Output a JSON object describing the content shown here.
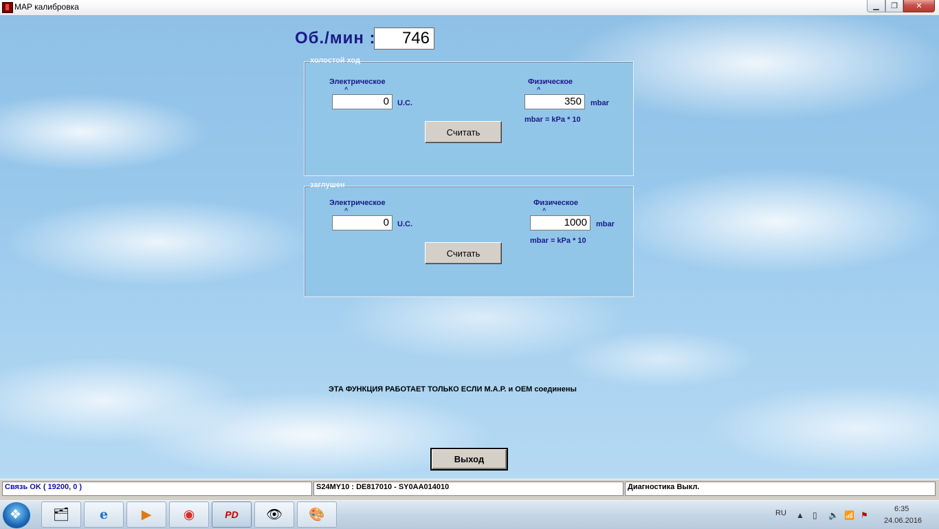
{
  "window": {
    "title": "MAP калибровка",
    "buttons": {
      "minimize": "▁",
      "maximize": "❐",
      "close": "✕"
    }
  },
  "rpm": {
    "label": "Об./мин :",
    "value": "746"
  },
  "idle_panel": {
    "caption": "холостой ход",
    "electrical": {
      "label": "Электрическое",
      "value": "0",
      "unit": "U.C."
    },
    "physical": {
      "label": "Физическое",
      "value": "350",
      "unit": "mbar",
      "formula": "mbar = kPa * 10"
    },
    "read_button": "Считать"
  },
  "stopped_panel": {
    "caption": "заглушен",
    "electrical": {
      "label": "Электрическое",
      "value": "0",
      "unit": "U.C."
    },
    "physical": {
      "label": "Физическое",
      "value": "1000",
      "unit": "mbar",
      "formula": "mbar = kPa * 10"
    },
    "read_button": "Считать"
  },
  "notice": "ЭТА ФУНКЦИЯ РАБОТАЕТ ТОЛЬКО ЕСЛИ М.А.Р. и ОЕМ соединены",
  "exit_button": "Выход",
  "status_bar": {
    "connection": "Связь OK ( 19200,  0 )",
    "ecu": "S24MY10 : DE817010 - SY0AA014010",
    "diagnostics": "Диагностика Выкл."
  },
  "taskbar": {
    "apps": [
      {
        "name": "explorer-icon",
        "glyph": "🗂"
      },
      {
        "name": "internet-explorer-icon",
        "glyph": "e"
      },
      {
        "name": "media-player-icon",
        "glyph": "▶"
      },
      {
        "name": "chrome-icon",
        "glyph": "◉"
      },
      {
        "name": "pd-app-icon",
        "glyph": "PD"
      },
      {
        "name": "eye-app-icon",
        "glyph": "👁"
      },
      {
        "name": "paint-icon",
        "glyph": "🎨"
      }
    ],
    "language": "RU",
    "time": "6:35",
    "date": "24.06.2016"
  },
  "colors": {
    "label_blue": "#1a1a86",
    "panel_bg": "#92c6e9",
    "status_blue": "#1010b0"
  }
}
